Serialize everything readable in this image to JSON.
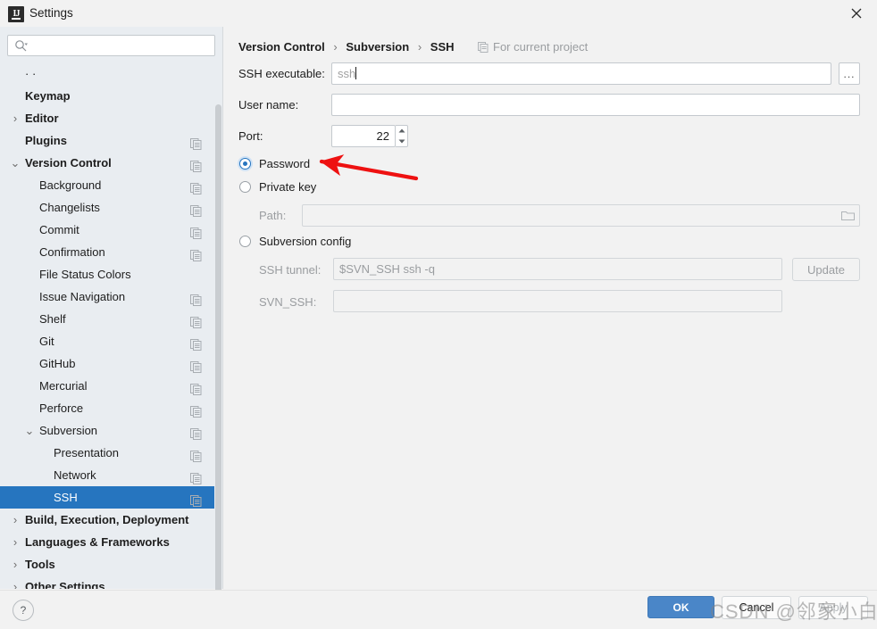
{
  "window": {
    "title": "Settings",
    "app_icon": "intellij-idea-icon",
    "close_icon": "close-icon"
  },
  "sidebar": {
    "search": {
      "value": "",
      "placeholder": "",
      "icon": "search-icon"
    },
    "items": [
      {
        "label": "· ·",
        "indent": 28,
        "bold": false,
        "arrow": "",
        "copy": false,
        "selected": false,
        "partial": true
      },
      {
        "label": "Keymap",
        "indent": 28,
        "bold": true,
        "arrow": "",
        "copy": false,
        "selected": false
      },
      {
        "label": "Editor",
        "indent": 28,
        "bold": true,
        "arrow": "›",
        "copy": false,
        "selected": false
      },
      {
        "label": "Plugins",
        "indent": 28,
        "bold": true,
        "arrow": "",
        "copy": true,
        "selected": false
      },
      {
        "label": "Version Control",
        "indent": 28,
        "bold": true,
        "arrow": "⌄",
        "copy": true,
        "selected": false
      },
      {
        "label": "Background",
        "indent": 44,
        "bold": false,
        "arrow": "",
        "copy": true,
        "selected": false
      },
      {
        "label": "Changelists",
        "indent": 44,
        "bold": false,
        "arrow": "",
        "copy": true,
        "selected": false
      },
      {
        "label": "Commit",
        "indent": 44,
        "bold": false,
        "arrow": "",
        "copy": true,
        "selected": false
      },
      {
        "label": "Confirmation",
        "indent": 44,
        "bold": false,
        "arrow": "",
        "copy": true,
        "selected": false
      },
      {
        "label": "File Status Colors",
        "indent": 44,
        "bold": false,
        "arrow": "",
        "copy": false,
        "selected": false
      },
      {
        "label": "Issue Navigation",
        "indent": 44,
        "bold": false,
        "arrow": "",
        "copy": true,
        "selected": false
      },
      {
        "label": "Shelf",
        "indent": 44,
        "bold": false,
        "arrow": "",
        "copy": true,
        "selected": false
      },
      {
        "label": "Git",
        "indent": 44,
        "bold": false,
        "arrow": "",
        "copy": true,
        "selected": false
      },
      {
        "label": "GitHub",
        "indent": 44,
        "bold": false,
        "arrow": "",
        "copy": true,
        "selected": false
      },
      {
        "label": "Mercurial",
        "indent": 44,
        "bold": false,
        "arrow": "",
        "copy": true,
        "selected": false
      },
      {
        "label": "Perforce",
        "indent": 44,
        "bold": false,
        "arrow": "",
        "copy": true,
        "selected": false
      },
      {
        "label": "Subversion",
        "indent": 44,
        "bold": false,
        "arrow": "⌄",
        "copy": true,
        "selected": false
      },
      {
        "label": "Presentation",
        "indent": 60,
        "bold": false,
        "arrow": "",
        "copy": true,
        "selected": false
      },
      {
        "label": "Network",
        "indent": 60,
        "bold": false,
        "arrow": "",
        "copy": true,
        "selected": false
      },
      {
        "label": "SSH",
        "indent": 60,
        "bold": false,
        "arrow": "",
        "copy": true,
        "selected": true
      },
      {
        "label": "Build, Execution, Deployment",
        "indent": 28,
        "bold": true,
        "arrow": "›",
        "copy": false,
        "selected": false
      },
      {
        "label": "Languages & Frameworks",
        "indent": 28,
        "bold": true,
        "arrow": "›",
        "copy": false,
        "selected": false
      },
      {
        "label": "Tools",
        "indent": 28,
        "bold": true,
        "arrow": "›",
        "copy": false,
        "selected": false
      },
      {
        "label": "Other Settings",
        "indent": 28,
        "bold": true,
        "arrow": "›",
        "copy": false,
        "selected": false
      }
    ]
  },
  "header": {
    "breadcrumb": [
      "Version Control",
      "Subversion",
      "SSH"
    ],
    "separator": "›",
    "scope_label": "For current project",
    "scope_icon": "copy-settings-icon"
  },
  "form": {
    "ssh_executable": {
      "label": "SSH executable:",
      "value": "ssh",
      "placeholder": "ssh",
      "browse_label": "...",
      "browse_icon": "ellipsis-icon"
    },
    "user_name": {
      "label": "User name:",
      "value": "",
      "placeholder": ""
    },
    "port": {
      "label": "Port:",
      "value": "22",
      "spinner_up_icon": "spinner-up-icon",
      "spinner_down_icon": "spinner-down-icon"
    },
    "auth_options": [
      {
        "id": "password",
        "label": "Password",
        "selected": true
      },
      {
        "id": "privatekey",
        "label": "Private key",
        "selected": false
      },
      {
        "id": "svnconfig",
        "label": "Subversion config",
        "selected": false
      }
    ],
    "path": {
      "label": "Path:",
      "value": "",
      "placeholder": "",
      "icon": "folder-icon",
      "disabled": true
    },
    "ssh_tunnel": {
      "label": "SSH tunnel:",
      "value": "$SVN_SSH ssh -q",
      "disabled": true
    },
    "svn_ssh": {
      "label": "SVN_SSH:",
      "value": "",
      "disabled": true
    },
    "update_button": "Update"
  },
  "footer": {
    "help_label": "?",
    "help_icon": "help-icon",
    "ok_label": "OK",
    "cancel_label": "Cancel",
    "apply_label": "Apply"
  },
  "watermark": {
    "text": "CSDN @邻家小白"
  },
  "annotation": {
    "arrow_color": "#ee1111",
    "points_to": "password-radio"
  },
  "colors": {
    "accent": "#2675bf",
    "selection": "#2675bf",
    "ok_button": "#4a86c8",
    "sidebar_bg": "#e9edf1",
    "content_bg": "#f2f2f2",
    "disabled_text": "#9a9da0"
  }
}
